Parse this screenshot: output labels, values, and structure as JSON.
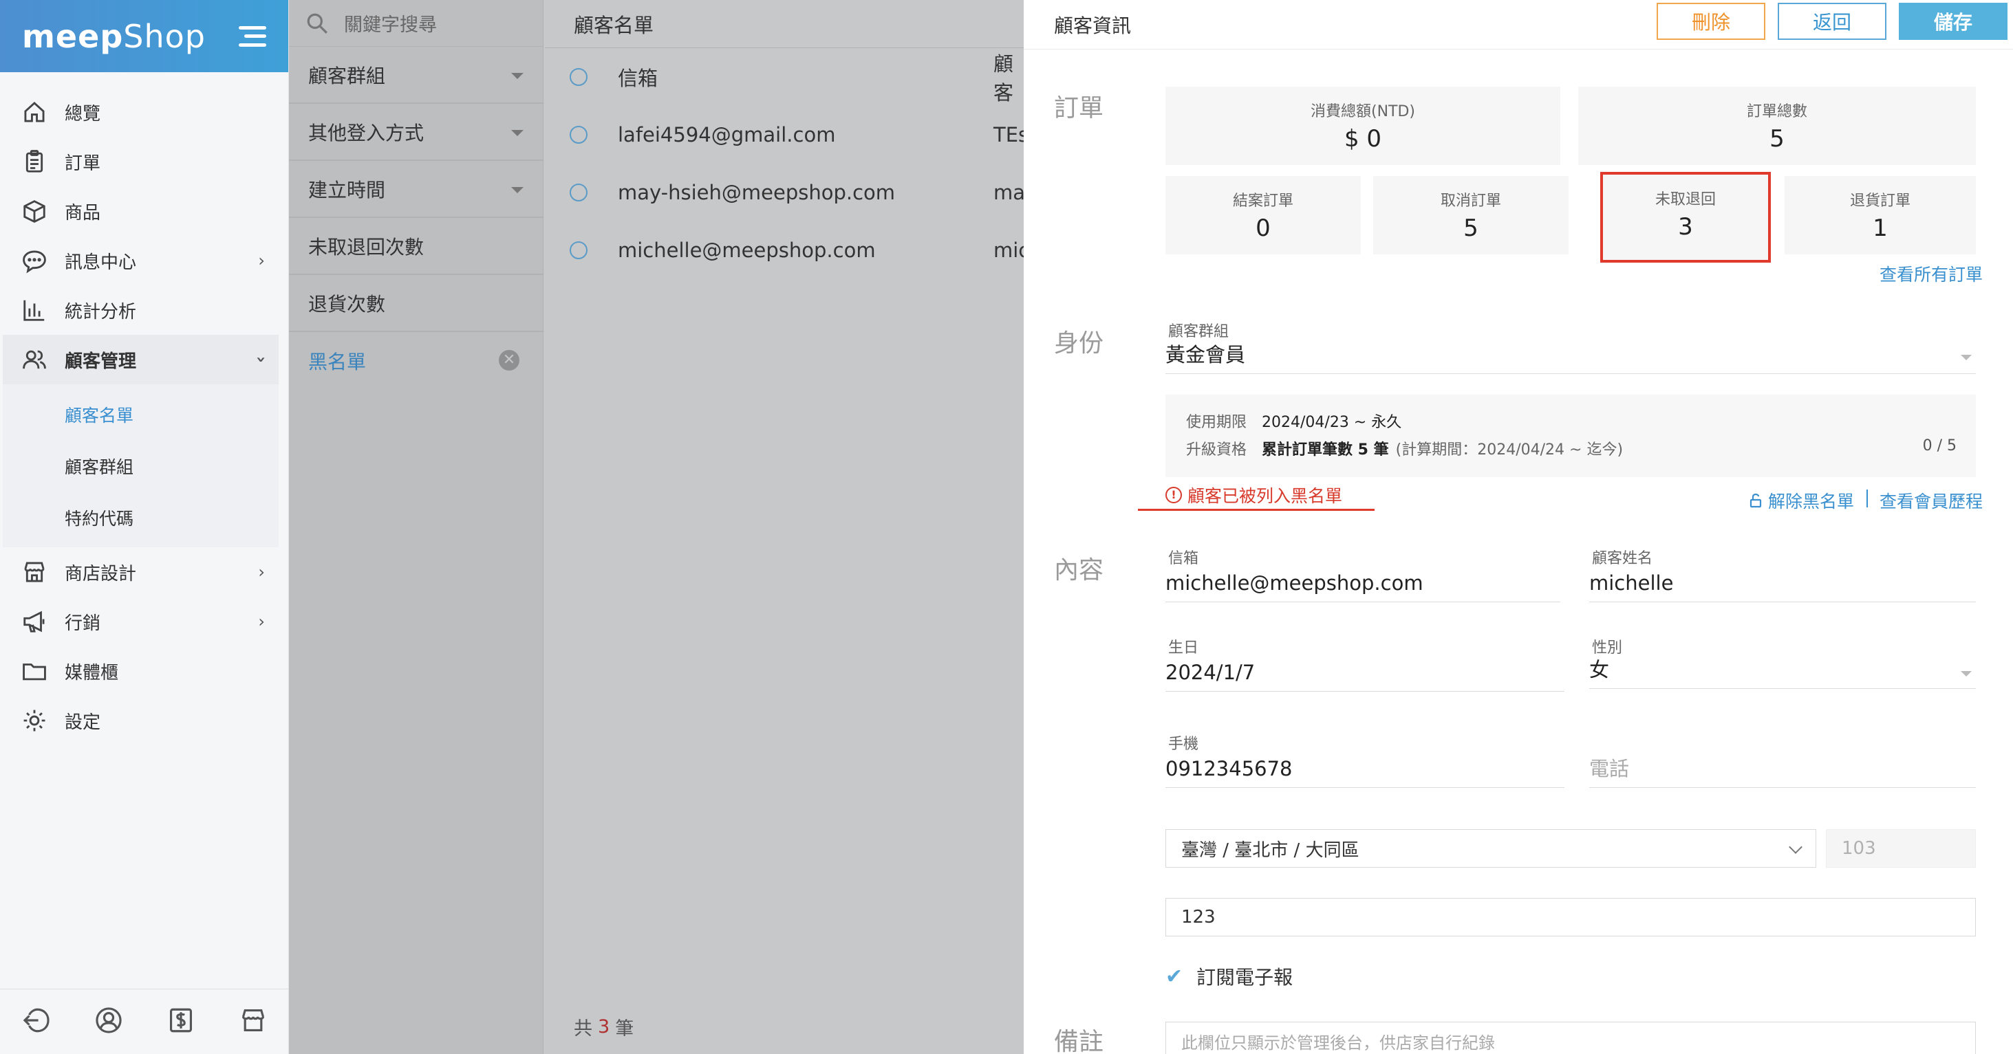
{
  "app": {
    "logo_a": "meep",
    "logo_b": "Shop"
  },
  "sidebar": {
    "items": [
      {
        "label": "總覽",
        "icon": "home-icon"
      },
      {
        "label": "訂單",
        "icon": "clipboard-icon"
      },
      {
        "label": "商品",
        "icon": "box-icon"
      },
      {
        "label": "訊息中心",
        "icon": "chat-icon"
      },
      {
        "label": "統計分析",
        "icon": "chart-icon"
      },
      {
        "label": "顧客管理",
        "icon": "users-icon"
      },
      {
        "label": "商店設計",
        "icon": "store-icon"
      },
      {
        "label": "行銷",
        "icon": "megaphone-icon"
      },
      {
        "label": "媒體櫃",
        "icon": "folder-icon"
      },
      {
        "label": "設定",
        "icon": "gear-icon"
      }
    ],
    "sub_items": [
      {
        "label": "顧客名單"
      },
      {
        "label": "顧客群組"
      },
      {
        "label": "特約代碼"
      }
    ]
  },
  "filters": {
    "search_placeholder": "關鍵字搜尋",
    "rows": [
      {
        "label": "顧客群組"
      },
      {
        "label": "其他登入方式"
      },
      {
        "label": "建立時間"
      },
      {
        "label": "未取退回次數"
      },
      {
        "label": "退貨次數"
      },
      {
        "label": "黑名單"
      }
    ]
  },
  "list": {
    "title": "顧客名單",
    "col_email": "信箱",
    "col_name": "顧客",
    "rows": [
      {
        "email": "lafei4594@gmail.com",
        "name": "TEs"
      },
      {
        "email": "may-hsieh@meepshop.com",
        "name": "mar"
      },
      {
        "email": "michelle@meepshop.com",
        "name": "mic"
      }
    ],
    "footer_prefix": "共",
    "footer_count": "3",
    "footer_suffix": "筆"
  },
  "detail": {
    "title": "顧客資訊",
    "buttons": {
      "delete": "刪除",
      "back": "返回",
      "save": "儲存"
    },
    "sections": {
      "orders": "訂單",
      "identity": "身份",
      "content": "內容",
      "remark": "備註"
    },
    "orders": {
      "total_spent_label": "消費總額(NTD)",
      "total_spent_value": "$ 0",
      "total_orders_label": "訂單總數",
      "total_orders_value": "5",
      "closed_label": "結案訂單",
      "closed_value": "0",
      "cancelled_label": "取消訂單",
      "cancelled_value": "5",
      "unclaimed_label": "未取退回",
      "unclaimed_value": "3",
      "returned_label": "退貨訂單",
      "returned_value": "1",
      "view_all": "查看所有訂單"
    },
    "identity": {
      "group_label": "顧客群組",
      "group_value": "黃金會員",
      "period_label": "使用期限",
      "period_value": "2024/04/23 ~ 永久",
      "upgrade_label": "升級資格",
      "upgrade_value": "累計訂單筆數 5 筆",
      "upgrade_note": "(計算期間：2024/04/24 ~ 迄今)",
      "upgrade_count": "0 / 5",
      "blacklist_warning": "顧客已被列入黑名單",
      "unblacklist": "解除黑名單",
      "view_history": "查看會員歷程"
    },
    "content": {
      "email_label": "信箱",
      "email_value": "michelle@meepshop.com",
      "name_label": "顧客姓名",
      "name_value": "michelle",
      "birthday_label": "生日",
      "birthday_value": "2024/1/7",
      "gender_label": "性別",
      "gender_value": "女",
      "mobile_label": "手機",
      "mobile_value": "0912345678",
      "phone_placeholder": "電話",
      "region_value": "臺灣 / 臺北市 / 大同區",
      "zip_value": "103",
      "address_value": "123",
      "subscribe_label": "訂閱電子報"
    },
    "remark_placeholder": "此欄位只顯示於管理後台，供店家自行紀錄"
  },
  "colors": {
    "accent": "#3a90cf",
    "warning": "#d83a2c",
    "delete": "#f0922b"
  }
}
